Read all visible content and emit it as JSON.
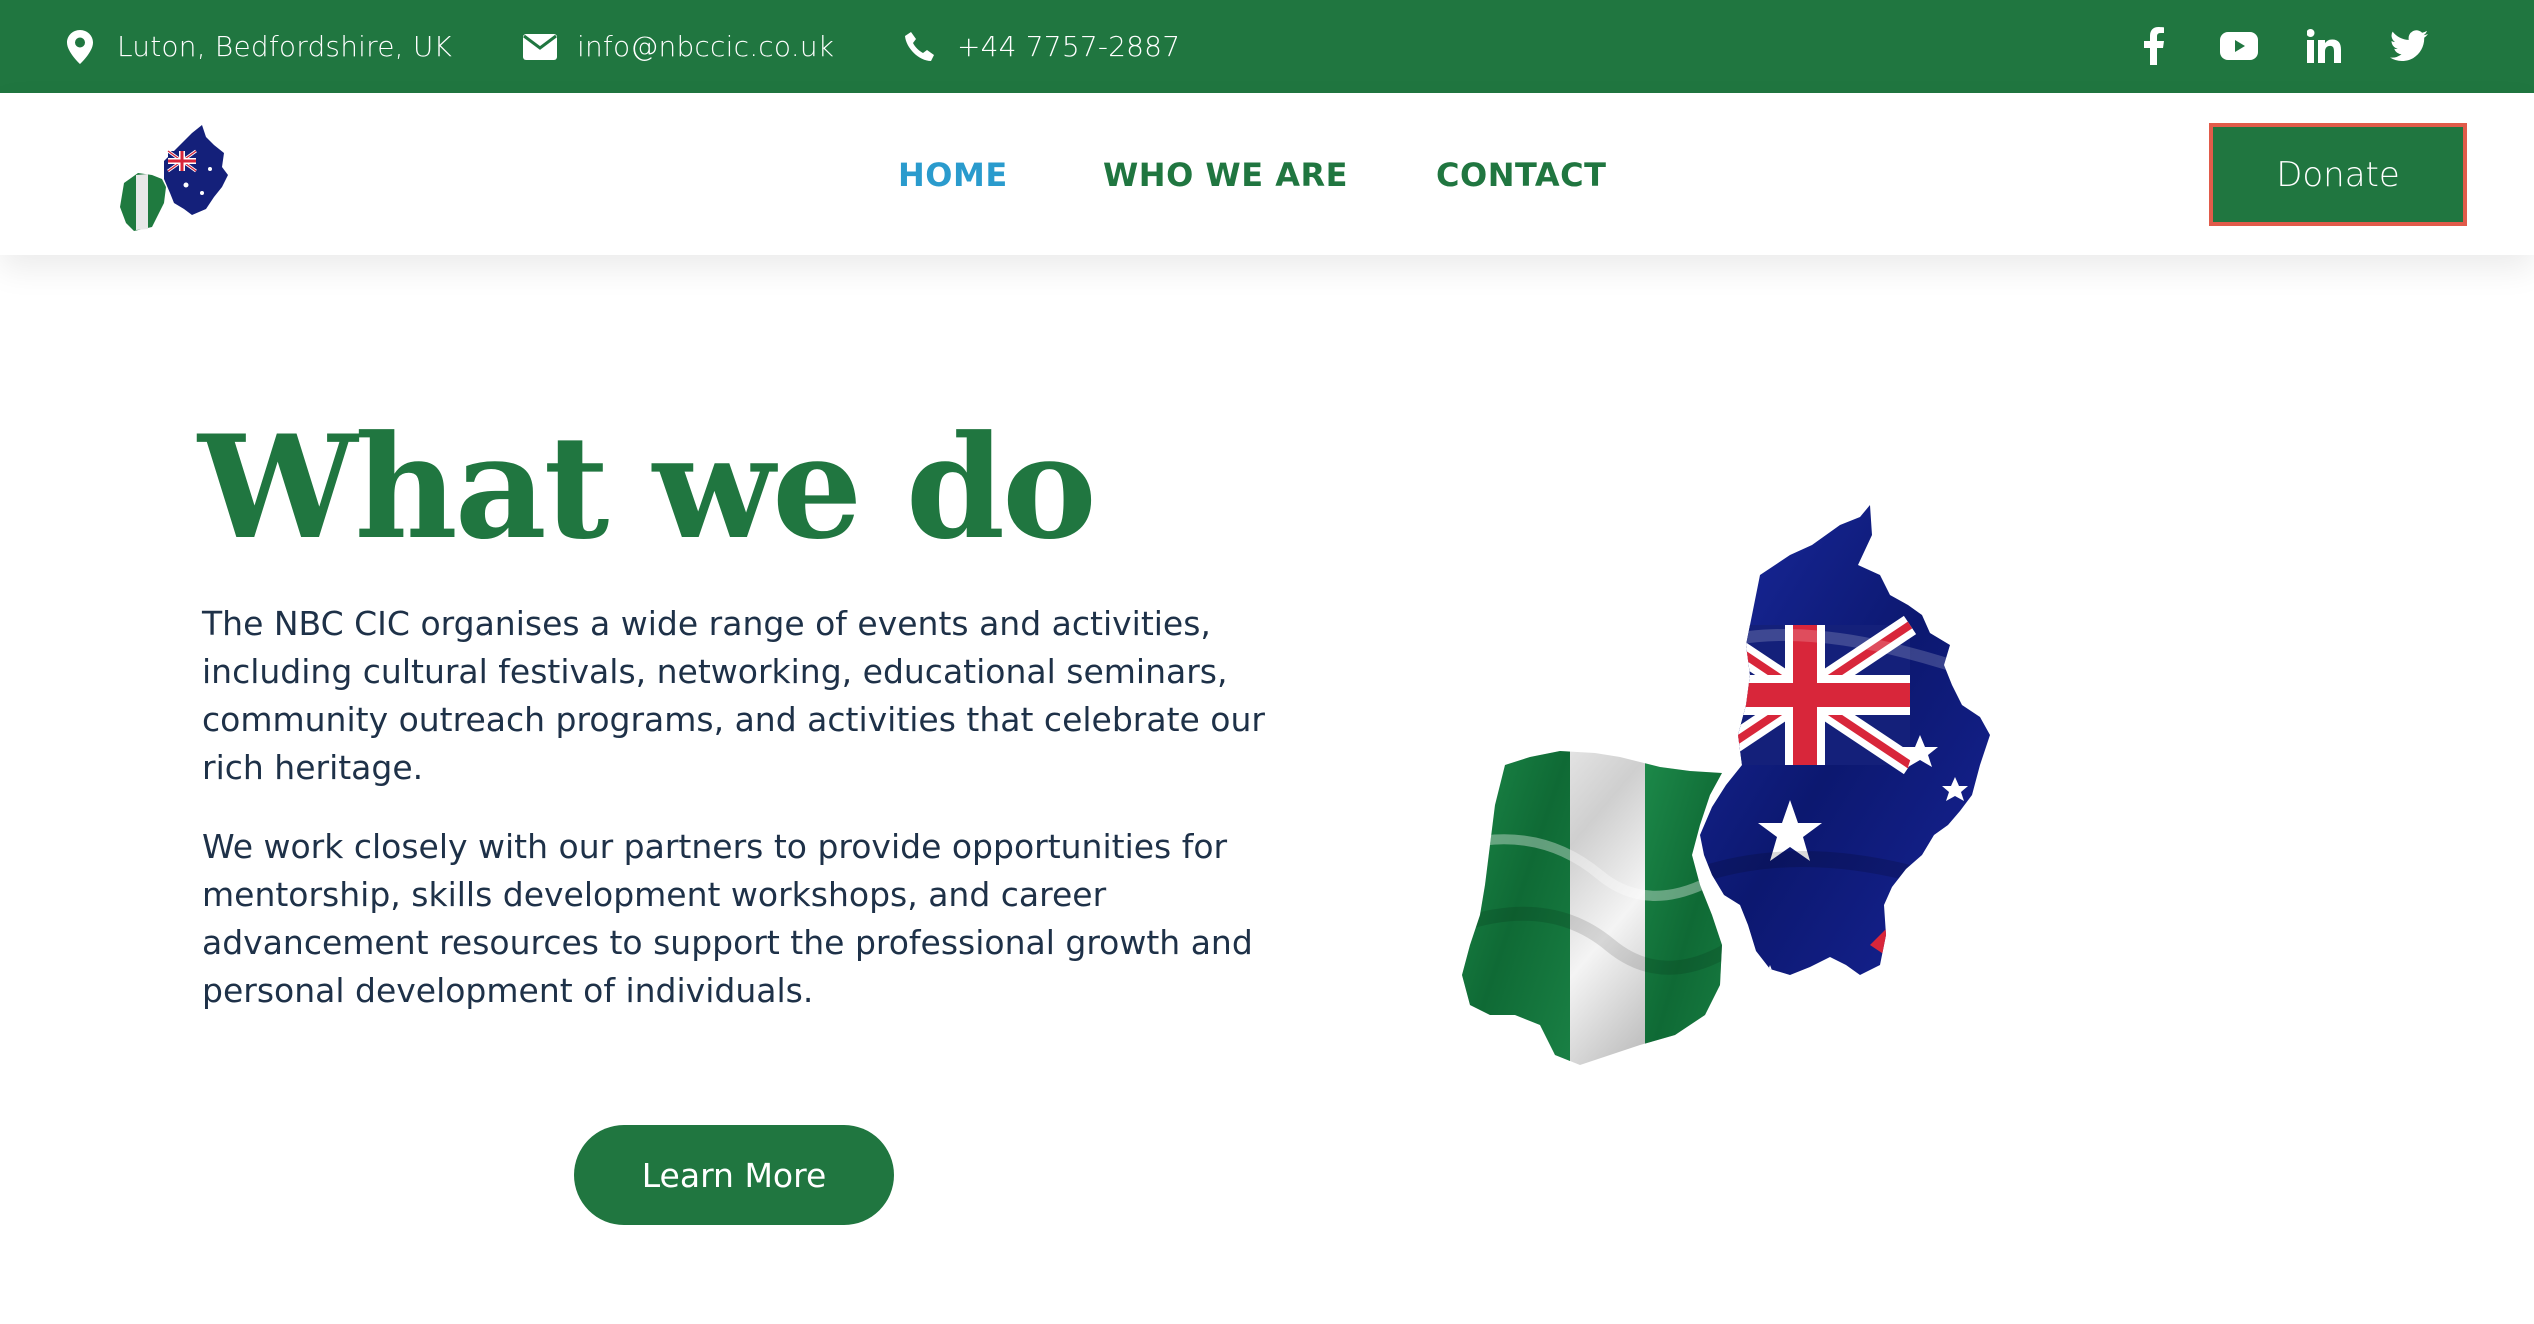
{
  "topbar": {
    "location": "Luton, Bedfordshire, UK",
    "email": "info@nbccic.co.uk",
    "phone": "+44 7757-2887",
    "icons": [
      "map-pin-icon",
      "envelope-icon",
      "phone-icon"
    ],
    "socials": [
      "facebook-icon",
      "youtube-icon",
      "linkedin-icon",
      "twitter-icon"
    ]
  },
  "nav": {
    "items": [
      {
        "label": "HOME",
        "active": true
      },
      {
        "label": "WHO WE ARE",
        "active": false
      },
      {
        "label": "CONTACT",
        "active": false
      }
    ],
    "donate_label": "Donate"
  },
  "hero": {
    "title": "What we do",
    "paragraph1": "The NBC CIC organises a wide range of events and activities, including cultural festivals, networking, educational seminars, community outreach programs, and activities that celebrate our rich heritage.",
    "paragraph2": "We work closely with our partners to provide opportunities for mentorship,  skills development workshops, and career advancement resources to support the professional growth and personal development of individuals.",
    "button_label": "Learn More"
  },
  "colors": {
    "brand_green": "#207640",
    "active_link": "#2a9bcd",
    "donate_border": "#e15b4a",
    "body_text": "#1e3148"
  }
}
